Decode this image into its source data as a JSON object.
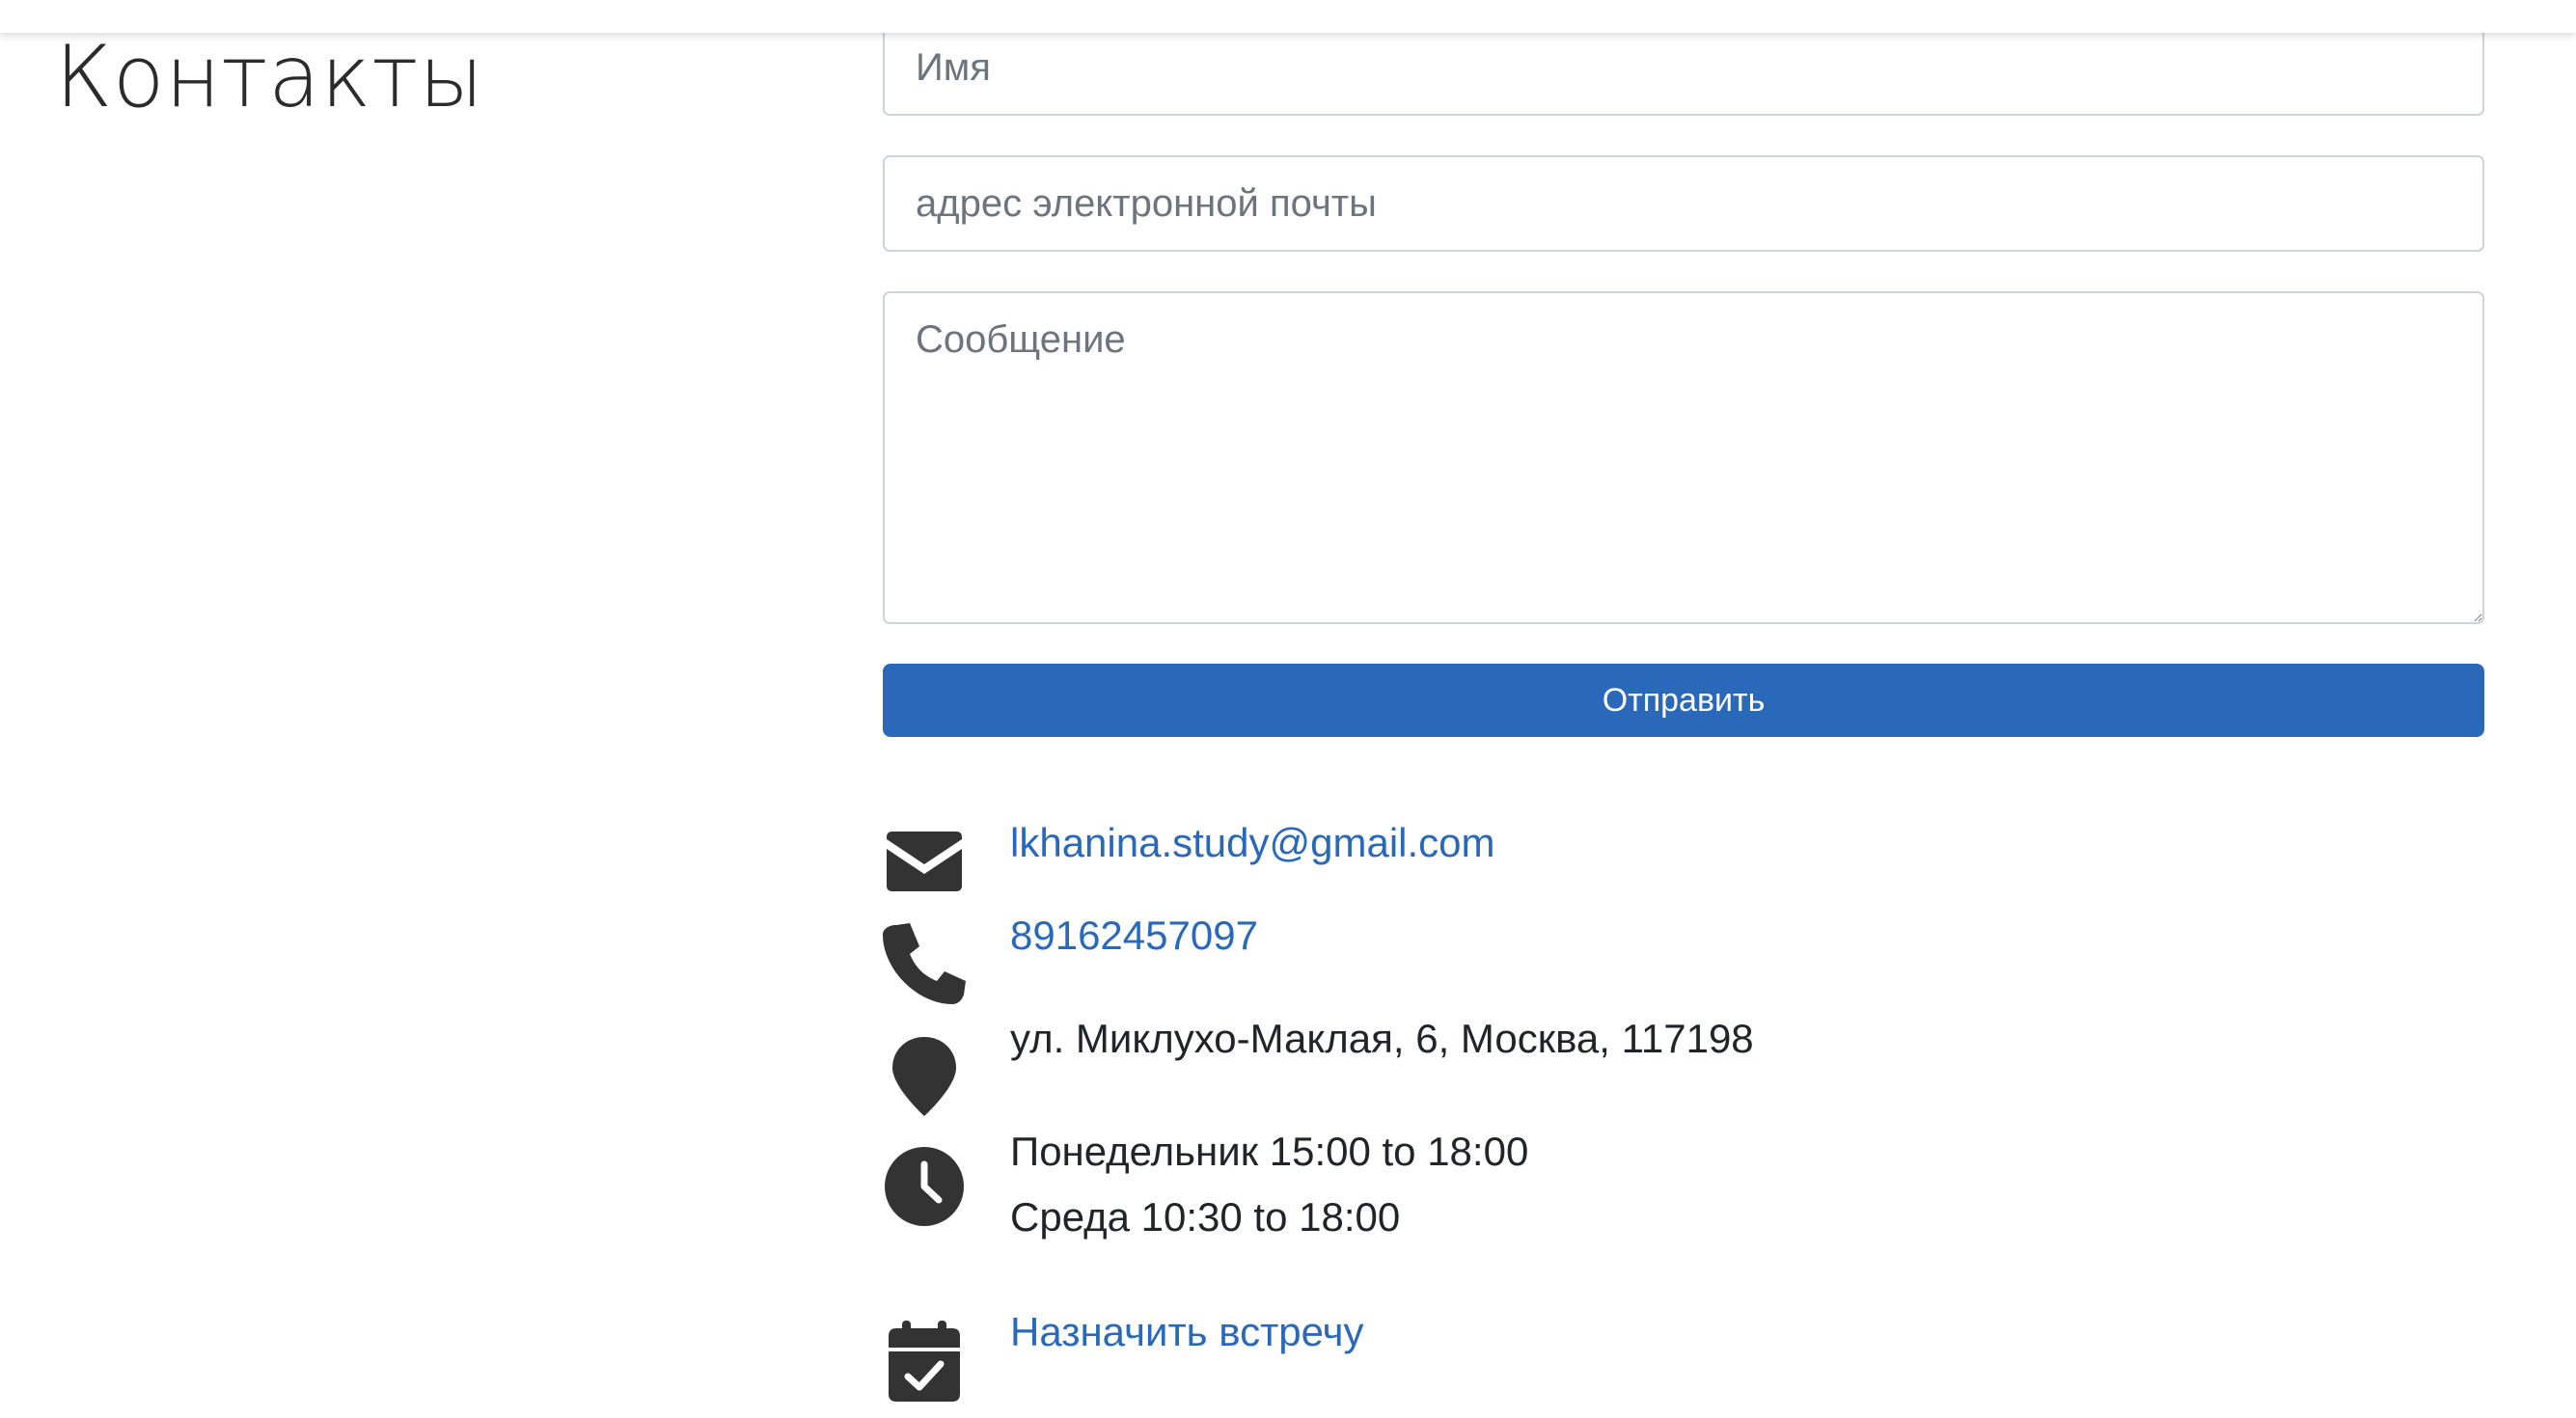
{
  "header": {
    "title": "Контакты"
  },
  "form": {
    "name_placeholder": "Имя",
    "email_placeholder": "адрес электронной почты",
    "message_placeholder": "Сообщение",
    "submit_label": "Отправить"
  },
  "contacts": {
    "email": "lkhanina.study@gmail.com",
    "phone": "89162457097",
    "address": "ул. Миклухо-Маклая, 6, Москва, 117198",
    "hours": [
      "Понедельник 15:00 to 18:00",
      "Среда 10:30 to 18:00"
    ],
    "meeting_link": "Назначить встречу"
  },
  "icons": {
    "email": "envelope-icon",
    "phone": "phone-icon",
    "address": "map-pin-icon",
    "hours": "clock-icon",
    "meeting": "calendar-check-icon"
  },
  "colors": {
    "accent": "#2a68b9",
    "icon": "#333333",
    "text": "#212529",
    "border": "#ced4da"
  }
}
